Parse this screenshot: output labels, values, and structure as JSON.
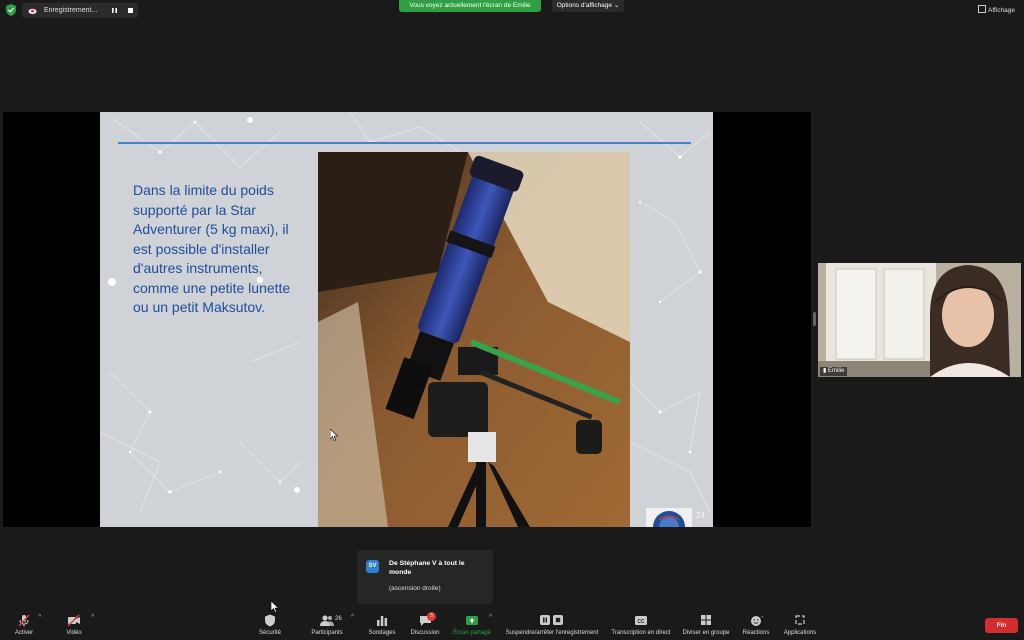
{
  "top": {
    "recording_label": "Enregistrement...",
    "share_banner": "Vous voyez actuellement l'écran de Emilie",
    "view_options": "Options d'affichage",
    "view_label": "Affichage"
  },
  "slide": {
    "text": "Dans la limite du poids supporté par la Star Adventurer (5 kg maxi), il est possible d'installer d'autres instruments, comme une petite lunette ou un petit Maksutov.",
    "page_number": "24"
  },
  "video": {
    "participant_name": "Emilie"
  },
  "chat_popup": {
    "avatar_initials": "SV",
    "from": "De Stéphane V à tout le monde",
    "message": "(ascension droite)"
  },
  "toolbar": {
    "activer": "Activer",
    "video": "Vidéo",
    "securite": "Sécurité",
    "participants": "Participants",
    "participants_count": "26",
    "sondages": "Sondages",
    "discussion": "Discussion",
    "discussion_badge": "3",
    "ecran_partage": "Écran partagé",
    "suspendre": "Suspendre/arrêter l'enregistrement",
    "transcription": "Transcription en direct",
    "diviser": "Diviser en groupe",
    "reactions": "Réactions",
    "applications": "Applications",
    "fin": "Fin"
  },
  "colors": {
    "share_green": "#2ea043",
    "end_red": "#d42d2d",
    "slide_text": "#1f4e9c",
    "slide_rule": "#3a86d6"
  }
}
